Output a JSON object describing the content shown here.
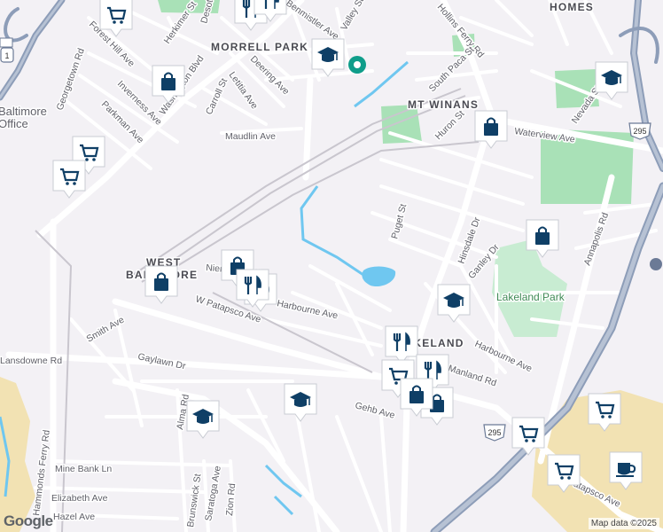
{
  "map": {
    "areas": [
      "HOMES",
      "MORRELL PARK",
      "MT WINANS",
      "WEST",
      "BALTIMORE",
      "LAKELAND",
      "Baltimore",
      "Office"
    ],
    "parks": [
      "Lakeland Park"
    ],
    "streets": [
      "Herkimer St",
      "Desoto Rd",
      "Benmistler Ave",
      "Valley St",
      "Hollins Ferry Rd",
      "Forest Hill Ave",
      "Georgetown Rd",
      "Inverness Ave",
      "Washington Blvd",
      "Letitia Ave",
      "Deering Ave",
      "Carroll St",
      "Parkman Ave",
      "Maudlin Ave",
      "South Paca St",
      "Huron St",
      "Waterview Ave",
      "Nevada St",
      "Puget St",
      "Hinsdale Dr",
      "Ganley Dr",
      "Annapolis Rd",
      "Harbourne Ave",
      "Niemeyer Ave",
      "Hammonds Ferry Rd",
      "Smith Ave",
      "Lansdowne Rd",
      "Gaylawn Dr",
      "W Patapsco Ave",
      "Alma Rd",
      "Gehb Ave",
      "Mine Bank Ln",
      "Elizabeth Ave",
      "Hazel Ave",
      "Saratoga Ave",
      "Brunswick St",
      "Zion Rd",
      "Harbourne Ave",
      "Manland Rd",
      "Patapsco Ave"
    ],
    "highway_shields": [
      "295",
      "295",
      "1"
    ],
    "attribution": "Map data ©2025",
    "logo": "Google"
  },
  "markers": [
    {
      "icon": "shopping-cart-icon"
    },
    {
      "icon": "restaurant-icon"
    },
    {
      "icon": "restaurant-icon"
    },
    {
      "icon": "school-icon"
    },
    {
      "icon": "shopping-bag-icon"
    },
    {
      "icon": "shopping-cart-icon"
    },
    {
      "icon": "shopping-cart-icon"
    },
    {
      "icon": "shopping-bag-icon"
    },
    {
      "icon": "school-icon"
    },
    {
      "icon": "shopping-bag-icon"
    },
    {
      "icon": "shopping-bag-icon"
    },
    {
      "icon": "shopping-bag-icon"
    },
    {
      "icon": "restaurant-icon"
    },
    {
      "icon": "restaurant-icon"
    },
    {
      "icon": "school-icon"
    },
    {
      "icon": "restaurant-icon"
    },
    {
      "icon": "school-icon"
    },
    {
      "icon": "school-icon"
    },
    {
      "icon": "shopping-cart-icon"
    },
    {
      "icon": "restaurant-icon"
    },
    {
      "icon": "shopping-bag-icon"
    },
    {
      "icon": "shopping-cart-icon"
    },
    {
      "icon": "shopping-cart-icon"
    },
    {
      "icon": "shopping-cart-icon"
    },
    {
      "icon": "coffee-icon"
    },
    {
      "icon": "shopping-bag-icon"
    }
  ],
  "colors": {
    "land": "#f3f1f5",
    "road": "#ffffff",
    "road_edge": "#d9d6de",
    "highway": "#8d9db8",
    "water": "#6fc7f0",
    "park": "#a9e1b7",
    "sand": "#f2e2b3",
    "marker_bg": "#ffffff",
    "marker_fg": "#0f3f66"
  }
}
